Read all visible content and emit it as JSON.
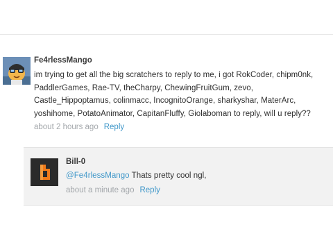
{
  "comments": [
    {
      "username": "Fe4rlessMango",
      "avatar_icon": "goggles-character-avatar-icon",
      "text_lines": [
        "im trying to get all the big scratchers to reply to me, i got RokCoder, chipm0nk,",
        "PaddlerGames, Rae-TV, theCharpy, ChewingFruitGum, zevo,",
        "Castle_Hippoptamus, colinmacc, IncognitoOrange, sharkyshar, MaterArc,",
        "yoshihome, PotatoAnimator, CapitanFluffy, Giolaboman to reply, will u reply??"
      ],
      "time": "about 2 hours ago",
      "reply_label": "Reply"
    }
  ],
  "replies": [
    {
      "username": "Bill-0",
      "avatar_icon": "orange-logo-avatar-icon",
      "mention": "@Fe4rlessMango",
      "text": " Thats pretty cool ngl,",
      "time": "about a minute ago",
      "reply_label": "Reply"
    }
  ],
  "colors": {
    "link": "#3f97c9",
    "reply_background": "#f2f2f2",
    "meta_text": "#a3a7ab"
  }
}
